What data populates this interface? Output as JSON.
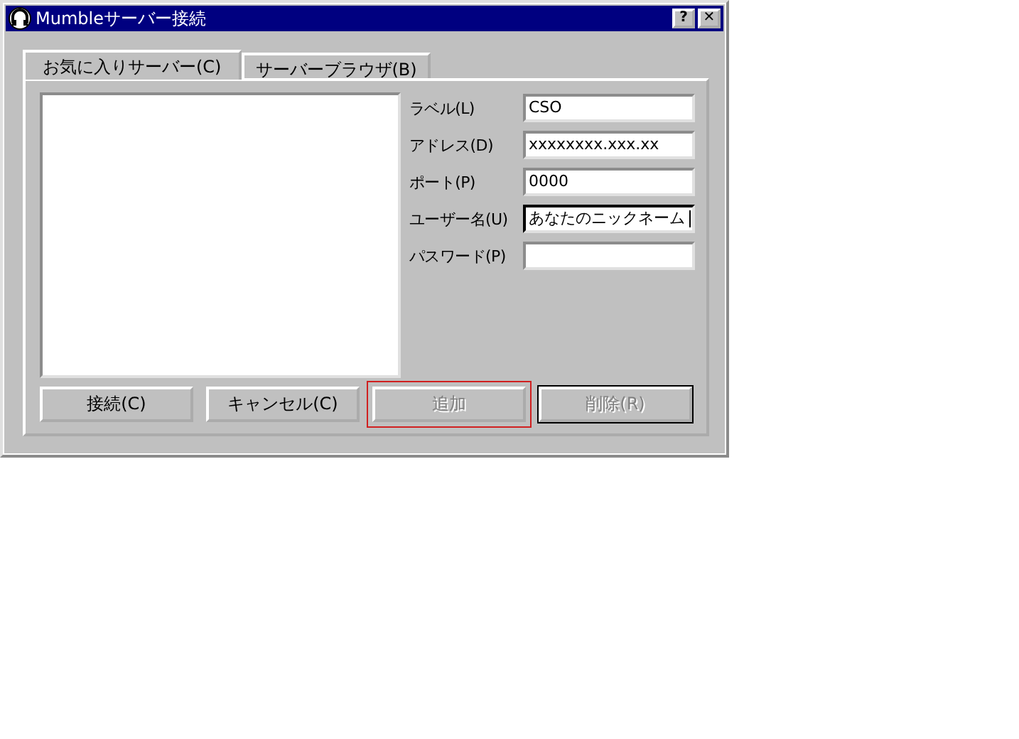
{
  "window": {
    "title": "Mumbleサーバー接続",
    "help_button": "?",
    "close_button": "✕"
  },
  "tabs": [
    {
      "label": "お気に入りサーバー(C)",
      "selected": true
    },
    {
      "label": "サーバーブラウザ(B)",
      "selected": false
    }
  ],
  "fields": [
    {
      "label": "ラベル(L)",
      "value": "CSO",
      "focused": false
    },
    {
      "label": "アドレス(D)",
      "value": "xxxxxxxx.xxx.xx",
      "focused": false
    },
    {
      "label": "ポート(P)",
      "value": "0000",
      "focused": false
    },
    {
      "label": "ユーザー名(U)",
      "value": "あなたのニックネーム",
      "focused": true
    },
    {
      "label": "パスワード(P)",
      "focused": false
    }
  ],
  "buttons": [
    {
      "label": "接続(C)",
      "disabled": false,
      "default": false,
      "highlighted": false
    },
    {
      "label": "キャンセル(C)",
      "disabled": false,
      "default": false,
      "highlighted": false
    },
    {
      "label": "追加",
      "disabled": true,
      "default": false,
      "highlighted": true
    },
    {
      "label": "削除(R)",
      "disabled": true,
      "default": true,
      "highlighted": false
    }
  ]
}
